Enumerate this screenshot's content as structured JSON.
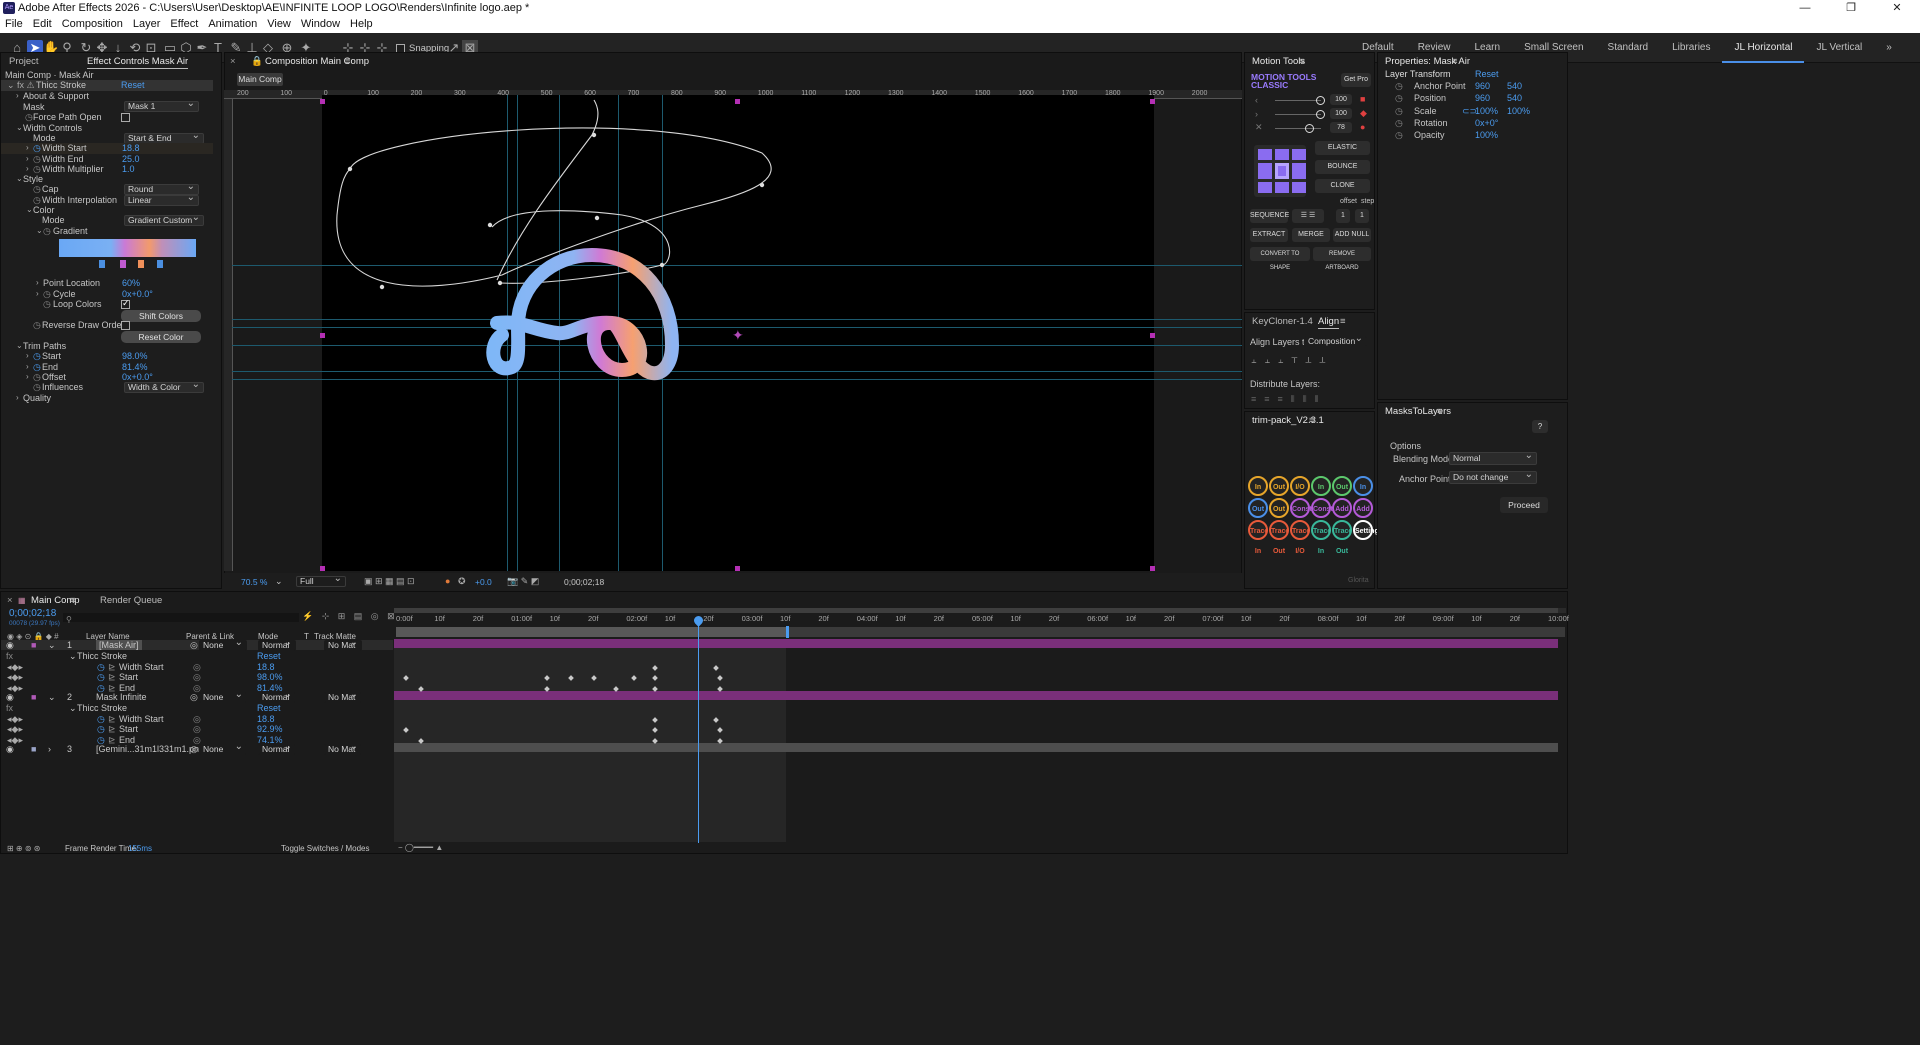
{
  "window": {
    "title": "Adobe After Effects 2026 - C:\\Users\\User\\Desktop\\AE\\INFINITE LOOP LOGO\\Renders\\Infinite logo.aep *",
    "app_icon": "Ae"
  },
  "menu": [
    "File",
    "Edit",
    "Composition",
    "Layer",
    "Effect",
    "Animation",
    "View",
    "Window",
    "Help"
  ],
  "toolbar": {
    "snapping_label": "Snapping"
  },
  "workspaces": [
    "Default",
    "Review",
    "Learn",
    "Small Screen",
    "Standard",
    "Libraries",
    "JL Horizontal",
    "JL Vertical"
  ],
  "left_panel": {
    "tabs": [
      "Project",
      "Effect Controls Mask Air"
    ],
    "breadcrumb": "Main Comp · Mask Air",
    "effect_name": "Thicc Stroke",
    "reset": "Reset",
    "rows": {
      "about": "About & Support",
      "mask": "Mask",
      "mask_value": "Mask 1",
      "force_path_open": "Force Path Open",
      "width_controls": "Width Controls",
      "mode": "Mode",
      "mode_value": "Start & End",
      "width_start": "Width Start",
      "width_start_v": "18.8",
      "width_end": "Width End",
      "width_end_v": "25.0",
      "width_mult": "Width Multiplier",
      "width_mult_v": "1.0",
      "style": "Style",
      "cap": "Cap",
      "cap_v": "Round",
      "width_interp": "Width Interpolation",
      "width_interp_v": "Linear",
      "color": "Color",
      "color_mode": "Mode",
      "color_mode_v": "Gradient Custom",
      "gradient": "Gradient",
      "point_location": "Point Location",
      "point_location_v": "60%",
      "cycle": "Cycle",
      "cycle_v": "0x+0.0°",
      "loop_colors": "Loop Colors",
      "shift_colors": "Shift Colors",
      "reverse_draw": "Reverse Draw Order",
      "reset_color": "Reset Color",
      "trim_paths": "Trim Paths",
      "start": "Start",
      "start_v": "98.0%",
      "end": "End",
      "end_v": "81.4%",
      "offset": "Offset",
      "offset_v": "0x+0.0°",
      "influences": "Influences",
      "influences_v": "Width & Color",
      "quality": "Quality"
    }
  },
  "comp_panel": {
    "tab": "Composition Main Comp",
    "sub_tab": "Main Comp",
    "zoom": "70.5 %",
    "resolution": "Full",
    "timecode": "0;00;02;18",
    "exposure": "+0.0",
    "ruler": [
      "200",
      "100",
      "0",
      "100",
      "200",
      "300",
      "400",
      "500",
      "600",
      "700",
      "800",
      "900",
      "1000",
      "1100",
      "1200",
      "1300",
      "1400",
      "1500",
      "1600",
      "1700",
      "1800",
      "1900",
      "2000"
    ]
  },
  "motion_tools": {
    "tab": "Motion Tools",
    "title": "MOTION TOOLS",
    "subtitle": "CLASSIC",
    "get_pro": "Get Pro",
    "sliders": [
      "100",
      "100",
      "78"
    ],
    "buttons": {
      "elastic": "ELASTIC",
      "bounce": "BOUNCE",
      "clone": "CLONE",
      "sequence": "SEQUENCE",
      "extract": "EXTRACT",
      "merge": "MERGE",
      "add_null": "ADD NULL",
      "convert": "CONVERT TO SHAPE",
      "remove_artboard": "REMOVE ARTBOARD",
      "offset": "offset",
      "step": "step",
      "offset_v": "1",
      "step_v": "1"
    }
  },
  "align_panel": {
    "tabs": [
      "KeyCloner-1.4",
      "Align"
    ],
    "align_to_label": "Align Layers to:",
    "align_to": "Composition",
    "distribute": "Distribute Layers:"
  },
  "trim_pack": {
    "tab": "trim-pack_V2.3.1",
    "icons": [
      "In",
      "Out",
      "I/O",
      "In",
      "Out",
      "In",
      "Out",
      "Out",
      "Const",
      "Const",
      "Add",
      "Add",
      "Trace In",
      "Trace Out",
      "Trace I/O",
      "Trace In",
      "Trace Out",
      "Settings"
    ]
  },
  "properties": {
    "tab": "Properties: Mask Air",
    "section": "Layer Transform",
    "reset": "Reset",
    "rows": [
      {
        "name": "Anchor Point",
        "v1": "960",
        "v2": "540"
      },
      {
        "name": "Position",
        "v1": "960",
        "v2": "540"
      },
      {
        "name": "Scale",
        "v1": "100%",
        "v2": "100%"
      },
      {
        "name": "Rotation",
        "v1": "0x+0°",
        "v2": ""
      },
      {
        "name": "Opacity",
        "v1": "100%",
        "v2": ""
      }
    ]
  },
  "masks_to_layers": {
    "tab": "MasksToLayers",
    "help": "?",
    "options": "Options",
    "blend_label": "Blending Mode:",
    "blend": "Normal",
    "anchor_label": "Anchor Point:",
    "anchor": "Do not change",
    "proceed": "Proceed"
  },
  "timeline": {
    "tabs": [
      "Main Comp",
      "Render Queue"
    ],
    "timecode": "0;00;02;18",
    "fps": "00078 (29.97 fps)",
    "columns": {
      "name": "Layer Name",
      "parent": "Parent & Link",
      "mode": "Mode",
      "t": "T",
      "track": "Track Matte"
    },
    "ruler": [
      "0:00f",
      "10f",
      "20f",
      "01:00f",
      "10f",
      "20f",
      "02:00f",
      "10f",
      "20f",
      "03:00f",
      "10f",
      "20f",
      "04:00f",
      "10f",
      "20f",
      "05:00f",
      "10f",
      "20f",
      "06:00f",
      "10f",
      "20f",
      "07:00f",
      "10f",
      "20f",
      "08:00f",
      "10f",
      "20f",
      "09:00f",
      "10f",
      "20f",
      "10:00f"
    ],
    "layers": [
      {
        "num": "1",
        "name": "[Mask Air]",
        "parent": "None",
        "mode": "Normal",
        "matte": "No Mat"
      },
      {
        "num": "2",
        "name": "Mask Infinite",
        "parent": "None",
        "mode": "Normal",
        "matte": "No Mat"
      },
      {
        "num": "3",
        "name": "[Gemini...31m1l331m1.png]",
        "parent": "None",
        "mode": "Normal",
        "matte": "No Mat"
      }
    ],
    "sub1": {
      "effect": "Thicc Stroke",
      "reset": "Reset",
      "ws": "Width Start",
      "ws_v": "18.8",
      "st": "Start",
      "st_v": "98.0%",
      "en": "End",
      "en_v": "81.4%"
    },
    "sub2": {
      "effect": "Thicc Stroke",
      "reset": "Reset",
      "ws": "Width Start",
      "ws_v": "18.8",
      "st": "Start",
      "st_v": "92.9%",
      "en": "End",
      "en_v": "74.1%"
    },
    "frame_render_label": "Frame Render Time:",
    "frame_render": "155ms",
    "toggle": "Toggle Switches / Modes",
    "watermark": "Glorita"
  },
  "colors": {
    "accent": "#4b9cf0",
    "layer_bar": "#7a2f7a",
    "guide": "#1d5a6e",
    "gradient": [
      "#6aa8f5",
      "#c97ad6",
      "#f29a6c",
      "#6aa8f5"
    ]
  }
}
